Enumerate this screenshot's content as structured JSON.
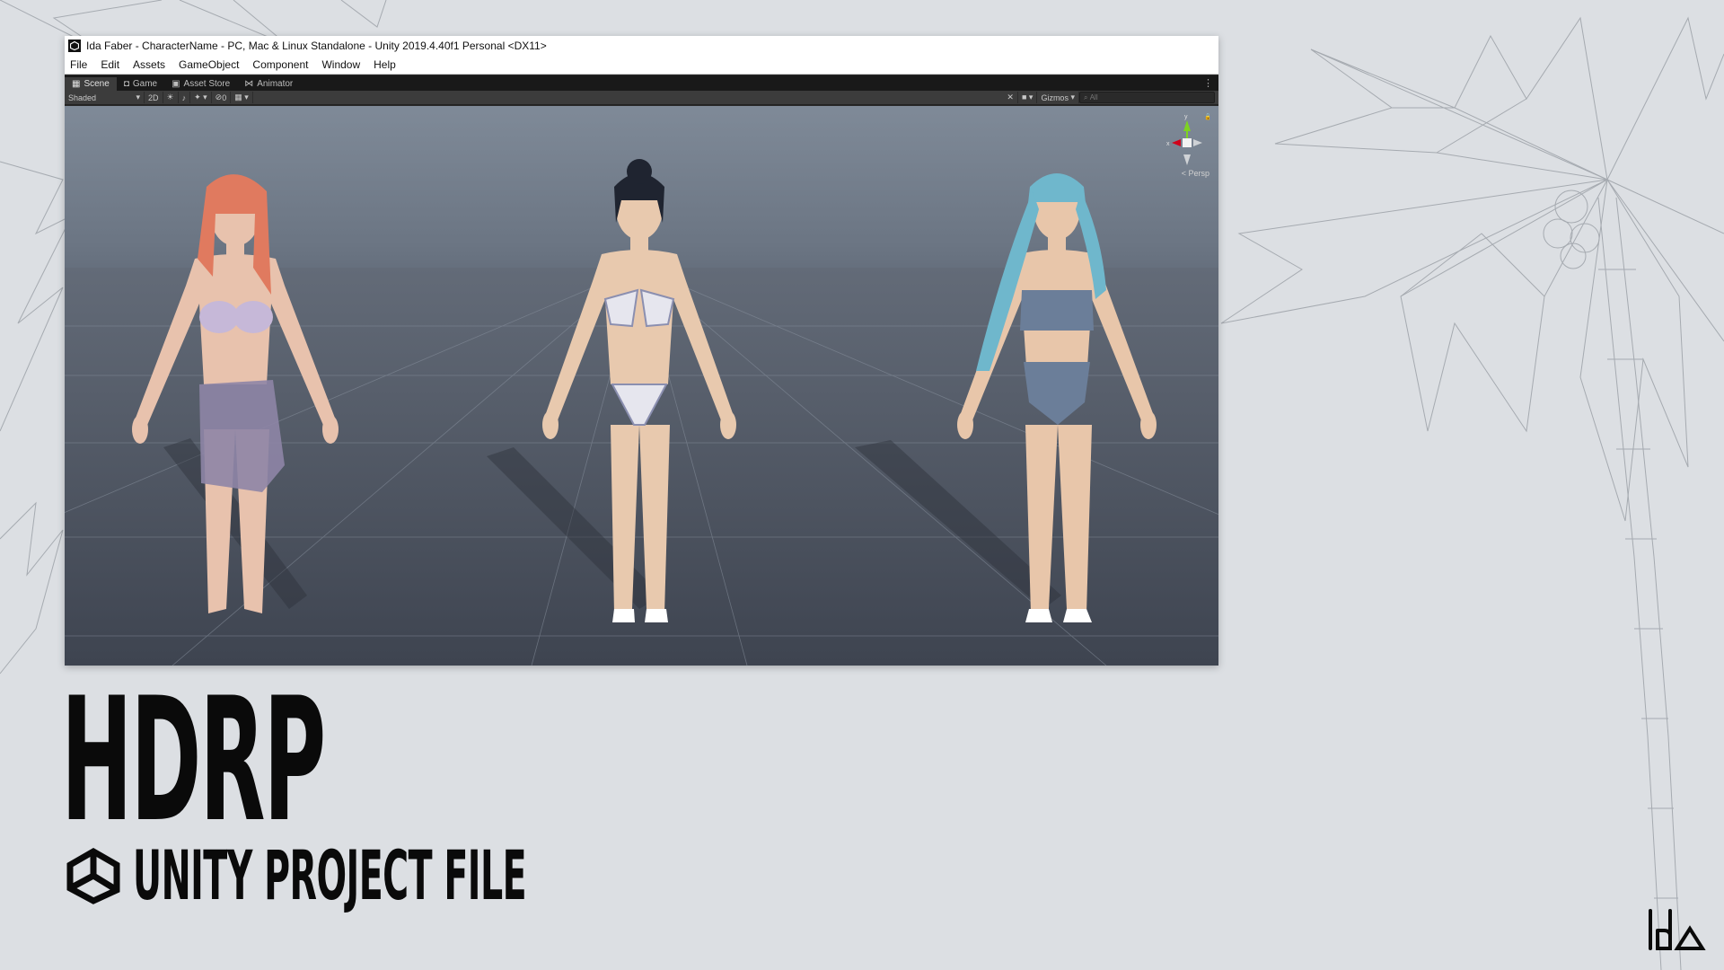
{
  "window": {
    "title": "Ida Faber - CharacterName - PC, Mac & Linux Standalone - Unity 2019.4.40f1 Personal <DX11>"
  },
  "menu": [
    "File",
    "Edit",
    "Assets",
    "GameObject",
    "Component",
    "Window",
    "Help"
  ],
  "tabs": [
    {
      "label": "Scene",
      "active": true,
      "icon": "grid-icon"
    },
    {
      "label": "Game",
      "active": false,
      "icon": "gamepad-icon"
    },
    {
      "label": "Asset Store",
      "active": false,
      "icon": "store-icon"
    },
    {
      "label": "Animator",
      "active": false,
      "icon": "animator-icon"
    }
  ],
  "toolbar": {
    "shading_mode": "Shaded",
    "mode_2d": "2D",
    "hidden_count": "0",
    "gizmos_label": "Gizmos",
    "search_placeholder": "All"
  },
  "scene": {
    "orientation_y": "y",
    "orientation_x": "x",
    "projection": "< Persp"
  },
  "slide": {
    "headline": "HDRP",
    "subtitle": "UNITY PROJECT FILE"
  },
  "colors": {
    "background": "#dcdfe3",
    "text": "#0a0a0a",
    "viewport_sky": "#7f8a98",
    "viewport_ground": "#464d59"
  }
}
